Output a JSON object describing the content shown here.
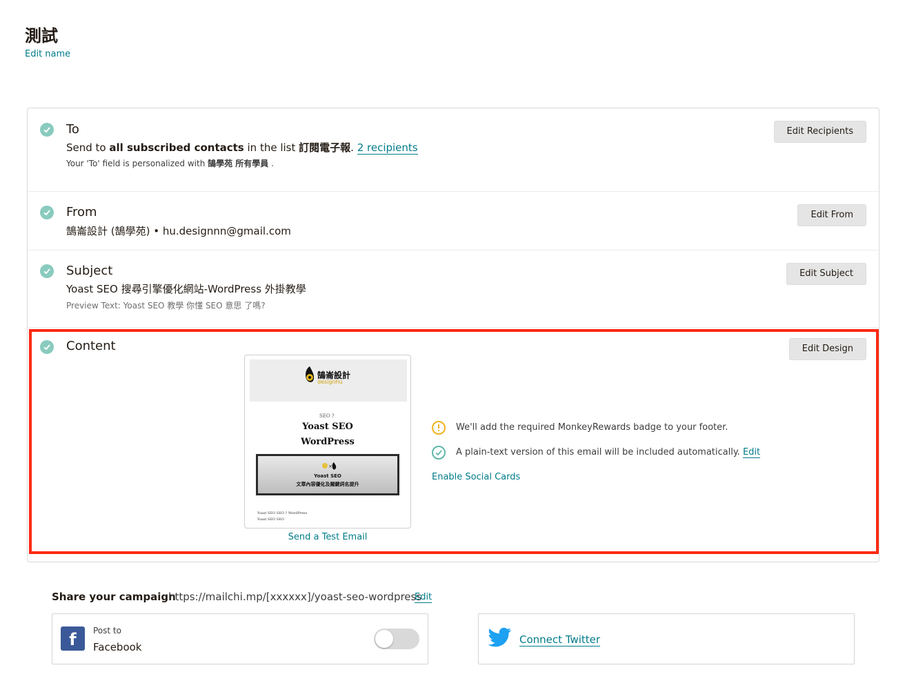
{
  "page": {
    "title": "測試",
    "edit_name": "Edit name"
  },
  "sections": {
    "to": {
      "title": "To",
      "line_prefix": "Send to ",
      "line_bold": "all subscribed contacts",
      "line_mid": " in the list ",
      "list_name": "訂閱電子報",
      "line_dot": ". ",
      "recipients": "2 recipients",
      "personalized_prefix": "Your 'To' field is personalized with ",
      "personalized_value": "鵠學苑 所有學員",
      "personalized_suffix": " .",
      "button": "Edit Recipients"
    },
    "from": {
      "title": "From",
      "line": "鵠崙設計 (鵠學苑) • hu.designnn@gmail.com",
      "button": "Edit From"
    },
    "subject": {
      "title": "Subject",
      "line": "Yoast SEO 搜尋引擎優化網站-WordPress 外掛教學",
      "preview_text": "Preview Text: Yoast SEO 教學 你懂 SEO 意思 了嗎?",
      "button": "Edit Subject"
    },
    "content": {
      "title": "Content",
      "button": "Edit Design",
      "preview": {
        "logo_text": "鵠崙設計",
        "logo_sub": "designhu",
        "tiny": "SEO ?",
        "headline_1": "Yoast SEO",
        "headline_2": "WordPress",
        "image_label_1": "Yoast SEO",
        "image_label_2": "文章內容優化及關鍵詞名提升",
        "footer_1": "Yoast SEO        SEO        ?        WordPress",
        "footer_2": "Yoast SEO                              SEO"
      },
      "send_test": "Send a Test Email",
      "notes": {
        "badge": "We'll add the required MonkeyRewards badge to your footer.",
        "plaintext": "A plain-text version of this email will be included automatically.",
        "plaintext_edit": "Edit",
        "social_cards": "Enable Social Cards"
      }
    }
  },
  "share": {
    "label": "Share your campaign",
    "url": "https://mailchi.mp/[xxxxxx]/yoast-seo-wordpress",
    "edit": "Edit",
    "facebook": {
      "post_to": "Post to",
      "name": "Facebook",
      "icon": "facebook-icon",
      "enabled": false
    },
    "twitter": {
      "link": "Connect Twitter",
      "icon": "twitter-icon"
    }
  },
  "colors": {
    "accent": "#007c89",
    "check": "#89cbbe",
    "highlight": "#ff2a12",
    "warning": "#efb320",
    "facebook": "#3b5998",
    "twitter": "#1da1f2"
  }
}
